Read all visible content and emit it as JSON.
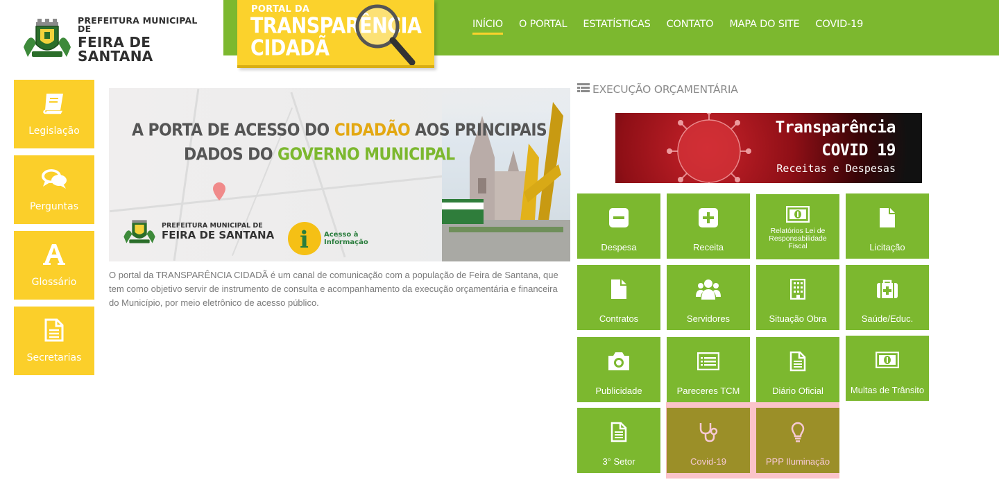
{
  "header": {
    "logo_line1": "PREFEITURA MUNICIPAL DE",
    "logo_line2": "FEIRA DE SANTANA",
    "portal_badge": {
      "line1": "PORTAL DA",
      "line2": "TRANSPARÊNCIA",
      "line3": "CIDADÃ"
    },
    "nav": [
      {
        "label": "INÍCIO",
        "active": true
      },
      {
        "label": "O PORTAL"
      },
      {
        "label": "ESTATÍSTICAS"
      },
      {
        "label": "CONTATO"
      },
      {
        "label": "MAPA DO SITE"
      },
      {
        "label": "COVID-19"
      }
    ],
    "colors": {
      "green": "#7cb82f",
      "yellow": "#fbd22c"
    }
  },
  "sidebar": {
    "items": [
      {
        "label": "Legislação",
        "icon": "book-icon"
      },
      {
        "label": "Perguntas",
        "icon": "chat-bubbles-icon"
      },
      {
        "label": "Glossário",
        "icon": "font-a-icon"
      },
      {
        "label": "Secretarias",
        "icon": "document-icon"
      }
    ]
  },
  "banner": {
    "line1_a": "A PORTA DE ACESSO DO ",
    "line1_b": "CIDADÃO",
    "line1_c": " AOS PRINCIPAIS",
    "line2_a": "DADOS DO ",
    "line2_b": "GOVERNO MUNICIPAL",
    "logo_line1": "PREFEITURA MUNICIPAL DE",
    "logo_line2": "FEIRA DE SANTANA",
    "acesso_line1": "Acesso à",
    "acesso_line2": "Informação"
  },
  "description": "O portal da TRANSPARÊNCIA CIDADÃ é um canal de comunicação com a população de Feira de Santana, que tem como objetivo servir de instrumento de consulta e acompanhamento da execução orçamentária e financeira do Município, por meio eletrônico de acesso público.",
  "execucao": {
    "title": "EXECUÇÃO ORÇAMENTÁRIA",
    "covid_banner": {
      "line1": "Transparência",
      "line2": "COVID 19",
      "line3": "Receitas e Despesas"
    },
    "tiles": [
      {
        "label": "Despesa",
        "icon": "minus-square-icon"
      },
      {
        "label": "Receita",
        "icon": "plus-square-icon"
      },
      {
        "label": "Relatórios Lei de Responsabilidade Fiscal",
        "icon": "money-bill-icon"
      },
      {
        "label": "Licitação",
        "icon": "file-icon"
      },
      {
        "label": "Contratos",
        "icon": "file-icon"
      },
      {
        "label": "Servidores",
        "icon": "users-icon"
      },
      {
        "label": "Situação Obra",
        "icon": "building-icon"
      },
      {
        "label": "Saúde/Educ.",
        "icon": "medkit-icon"
      },
      {
        "label": "Publicidade",
        "icon": "camera-icon"
      },
      {
        "label": "Pareceres TCM",
        "icon": "list-alt-icon"
      },
      {
        "label": "Diário Oficial",
        "icon": "file-text-icon"
      },
      {
        "label": "Multas de Trânsito",
        "icon": "money-bill-icon"
      },
      {
        "label": "3° Setor",
        "icon": "file-text-icon"
      },
      {
        "label": "Covid-19",
        "icon": "stethoscope-icon"
      },
      {
        "label": "PPP Iluminação",
        "icon": "lightbulb-icon"
      }
    ]
  }
}
